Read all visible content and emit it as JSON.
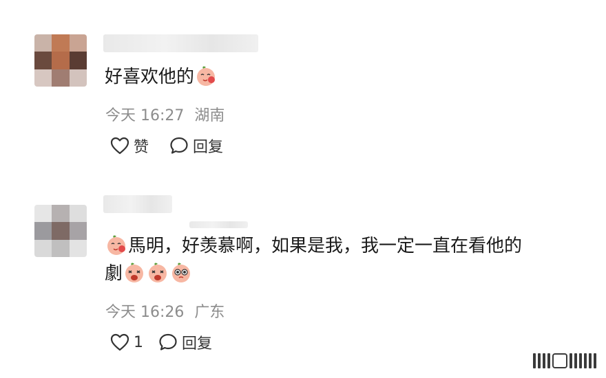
{
  "comments": [
    {
      "text": "好喜欢他的",
      "time": "今天 16:27",
      "location": "湖南",
      "like_label": "赞",
      "reply_label": "回复",
      "trailing_emojis": [
        "smiling-peach-emoji"
      ]
    },
    {
      "text_before": "馬明，好羡慕啊，如果是我，我一定一直在看他的",
      "text_after": "劇",
      "time": "今天 16:26",
      "location": "广东",
      "like_count": "1",
      "reply_label": "回复",
      "leading_emojis": [
        "smiling-peach-emoji"
      ],
      "trailing_emojis": [
        "crying-peach-emoji",
        "crying-peach-emoji",
        "pleading-peach-emoji"
      ]
    }
  ],
  "colors": {
    "text": "#1b1b1b",
    "meta": "#8c8c8c",
    "peach": "#f7b7a3",
    "cheek": "#e24b4b",
    "leaf": "#5c9f3b"
  }
}
